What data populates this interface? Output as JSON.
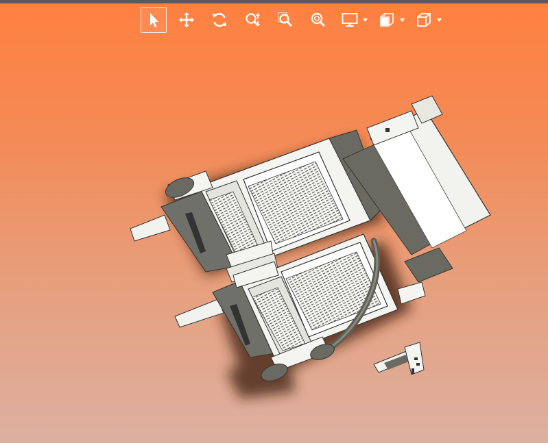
{
  "toolbar": {
    "tools": [
      {
        "id": "select",
        "icon": "select-arrow-icon",
        "active": true
      },
      {
        "id": "pan",
        "icon": "pan-move-icon"
      },
      {
        "id": "rotate",
        "icon": "rotate-icon"
      },
      {
        "id": "zoom",
        "icon": "zoom-updown-icon"
      },
      {
        "id": "zoom-area",
        "icon": "zoom-area-icon"
      },
      {
        "id": "zoom-fit",
        "icon": "zoom-fit-icon"
      }
    ],
    "dropdowns": [
      {
        "id": "display",
        "icon": "monitor-display-icon"
      },
      {
        "id": "section",
        "icon": "section-view-icon"
      },
      {
        "id": "view-orientation",
        "icon": "view-cube-icon"
      }
    ]
  },
  "colors": {
    "background_top": "#ff8040",
    "background_bottom": "#dcb0a0",
    "icon": "#ffffff",
    "model_light": "#f4f4f0",
    "model_dark": "#6a6a62",
    "model_shadow": "#2a1a10"
  }
}
